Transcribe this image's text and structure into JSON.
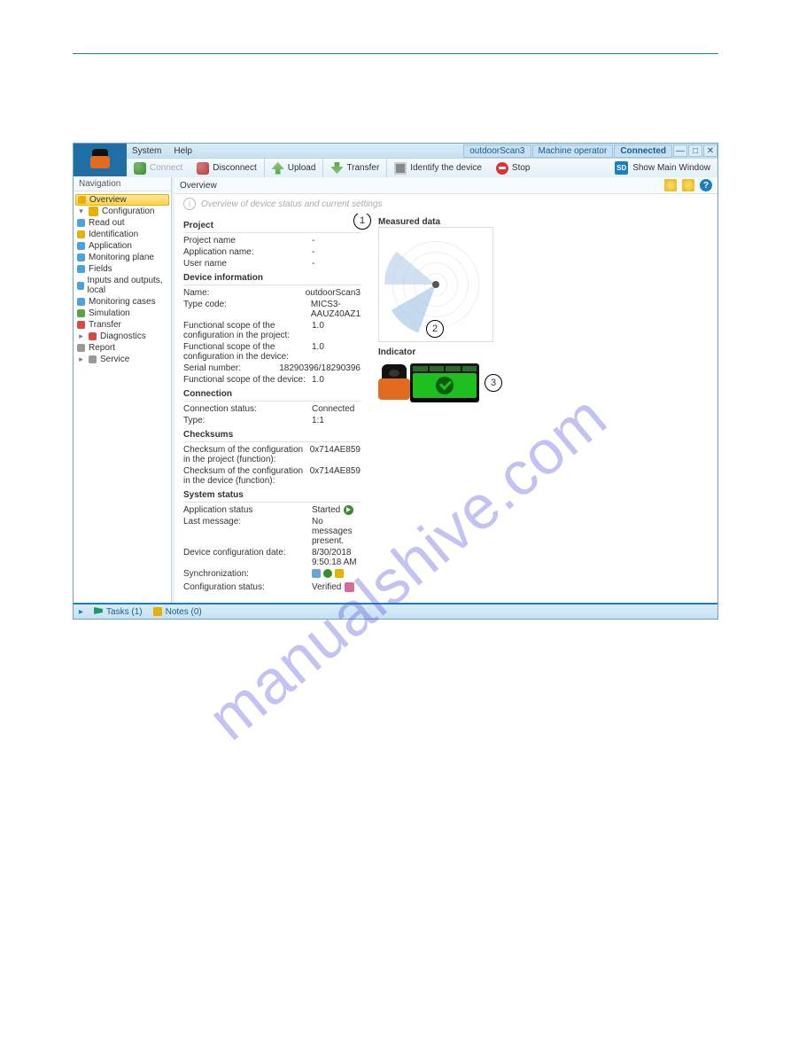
{
  "menubar": {
    "system": "System",
    "help": "Help"
  },
  "titlechips": {
    "device": "outdoorScan3",
    "role": "Machine operator",
    "conn": "Connected"
  },
  "toolbar": {
    "connect": "Connect",
    "disconnect": "Disconnect",
    "upload": "Upload",
    "transfer": "Transfer",
    "identify": "Identify the device",
    "stop": "Stop",
    "showmain": "Show Main Window"
  },
  "nav": {
    "header": "Navigation",
    "overview": "Overview",
    "configuration": "Configuration",
    "readout": "Read out",
    "identification": "Identification",
    "application": "Application",
    "monplane": "Monitoring plane",
    "fields": "Fields",
    "io": "Inputs and outputs, local",
    "moncases": "Monitoring cases",
    "simulation": "Simulation",
    "transfer": "Transfer",
    "diagnostics": "Diagnostics",
    "report": "Report",
    "service": "Service"
  },
  "content": {
    "header": "Overview",
    "subtitle": "Overview of device status and current settings",
    "project": {
      "title": "Project",
      "projectname_k": "Project name",
      "projectname_v": "-",
      "appname_k": "Application name:",
      "appname_v": "-",
      "username_k": "User name",
      "username_v": "-"
    },
    "devinfo": {
      "title": "Device information",
      "name_k": "Name:",
      "name_v": "outdoorScan3",
      "type_k": "Type code:",
      "type_v": "MICS3-AAUZ40AZ1",
      "fscope_proj_k": "Functional scope of the configuration in the project:",
      "fscope_proj_v": "1.0",
      "fscope_dev_k": "Functional scope of the configuration in the device:",
      "fscope_dev_v": "1.0",
      "serial_k": "Serial number:",
      "serial_v": "18290396/18290396",
      "fscope_devonly_k": "Functional scope of the device:",
      "fscope_devonly_v": "1.0"
    },
    "connection": {
      "title": "Connection",
      "status_k": "Connection status:",
      "status_v": "Connected",
      "type_k": "Type:",
      "type_v": "1:1"
    },
    "checksums": {
      "title": "Checksums",
      "proj_k": "Checksum of the configuration in the project (function):",
      "proj_v": "0x714AE859",
      "dev_k": "Checksum of the configuration in the device (function):",
      "dev_v": "0x714AE859"
    },
    "status": {
      "title": "System status",
      "app_k": "Application status",
      "app_v": "Started",
      "last_k": "Last message:",
      "last_v": "No messages present.",
      "date_k": "Device configuration date:",
      "date_v": "8/30/2018 9:50:18 AM",
      "sync_k": "Synchronization:",
      "cfgstat_k": "Configuration status:",
      "cfgstat_v": "Verified"
    },
    "measured": "Measured data",
    "indicator": "Indicator",
    "callouts": {
      "c1": "1",
      "c2": "2",
      "c3": "3"
    }
  },
  "taskbar": {
    "tasks": "Tasks (1)",
    "notes": "Notes (0)"
  },
  "watermark": "manualshive.com"
}
